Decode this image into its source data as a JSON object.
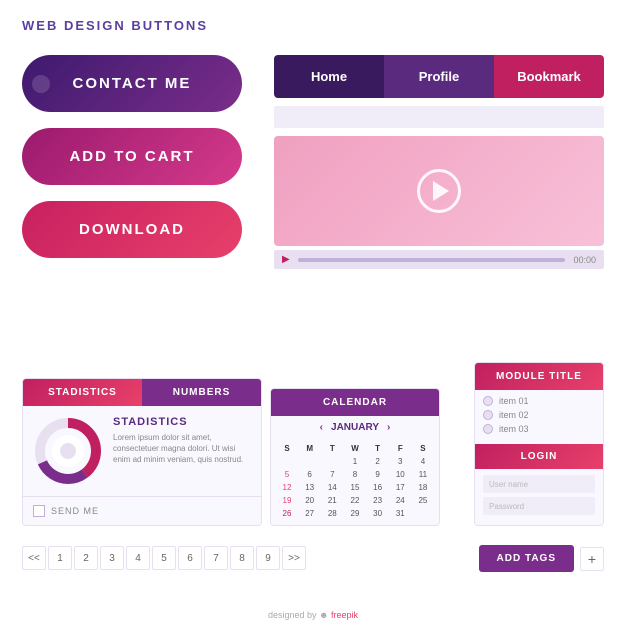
{
  "title": "WEB DESIGN BUTTONS",
  "buttons": {
    "contact": "CONTACT ME",
    "addcart": "ADD TO CART",
    "download": "DOWNLOAD"
  },
  "nav": {
    "home": "Home",
    "profile": "Profile",
    "bookmark": "Bookmark"
  },
  "video": {
    "time": "00:00"
  },
  "stats": {
    "tab1": "STADISTICS",
    "tab2": "NUMBERS",
    "title": "STADISTICS",
    "body": "Lorem ipsum dolor sit amet, consectetuer magna dolori. Ut wisi enim ad minim veniam, quis nostrud.",
    "sendme": "SEND ME"
  },
  "calendar": {
    "header": "CALENDAR",
    "month": "JANUARY",
    "days": [
      "S",
      "M",
      "T",
      "W",
      "T",
      "F",
      "S"
    ],
    "row1": [
      "",
      "",
      "",
      "1",
      "2",
      "3",
      "4"
    ],
    "row2": [
      "5",
      "6",
      "7",
      "8",
      "9",
      "10",
      "11"
    ],
    "row3": [
      "12",
      "13",
      "14",
      "15",
      "16",
      "17",
      "18"
    ],
    "row4": [
      "19",
      "20",
      "21",
      "22",
      "23",
      "24",
      "25"
    ],
    "row5": [
      "26",
      "27",
      "28",
      "29",
      "30",
      "31",
      ""
    ]
  },
  "module": {
    "title": "MODULE TITLE",
    "items": [
      "item 01",
      "item 02",
      "item 03"
    ],
    "login": "LOGIN",
    "username": "User name",
    "password": "Password"
  },
  "pagination": {
    "prev": "<<",
    "next": ">>",
    "pages": [
      "1",
      "2",
      "3",
      "4",
      "5",
      "6",
      "7",
      "8",
      "9"
    ]
  },
  "addtags": {
    "label": "ADD TAGS",
    "plus": "+"
  },
  "footer": "designed by  freepik"
}
